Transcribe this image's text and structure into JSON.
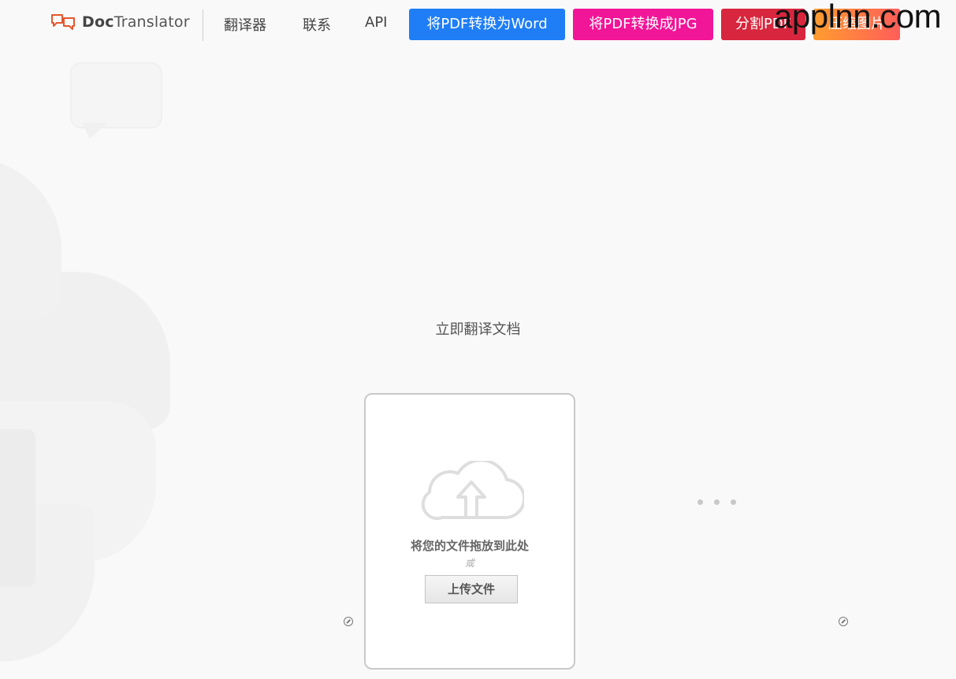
{
  "header": {
    "logo": {
      "bold": "Doc",
      "rest": "Translator"
    },
    "nav": [
      {
        "label": "翻译器"
      },
      {
        "label": "联系"
      },
      {
        "label": "API"
      }
    ],
    "pills": [
      {
        "label": "将PDF转换为Word",
        "color": "#1f7ef5"
      },
      {
        "label": "将PDF转换成JPG",
        "color": "#f11597"
      },
      {
        "label": "分割PDF",
        "color": "#d7263d"
      },
      {
        "label": "压缩图片",
        "color": "#ff7a45"
      }
    ],
    "watermark": "applnn.com"
  },
  "main": {
    "subtitle": "立即翻译文档",
    "dropzone": {
      "drop_text": "将您的文件拖放到此处",
      "or_text": "或",
      "upload_button": "上传文件"
    }
  }
}
